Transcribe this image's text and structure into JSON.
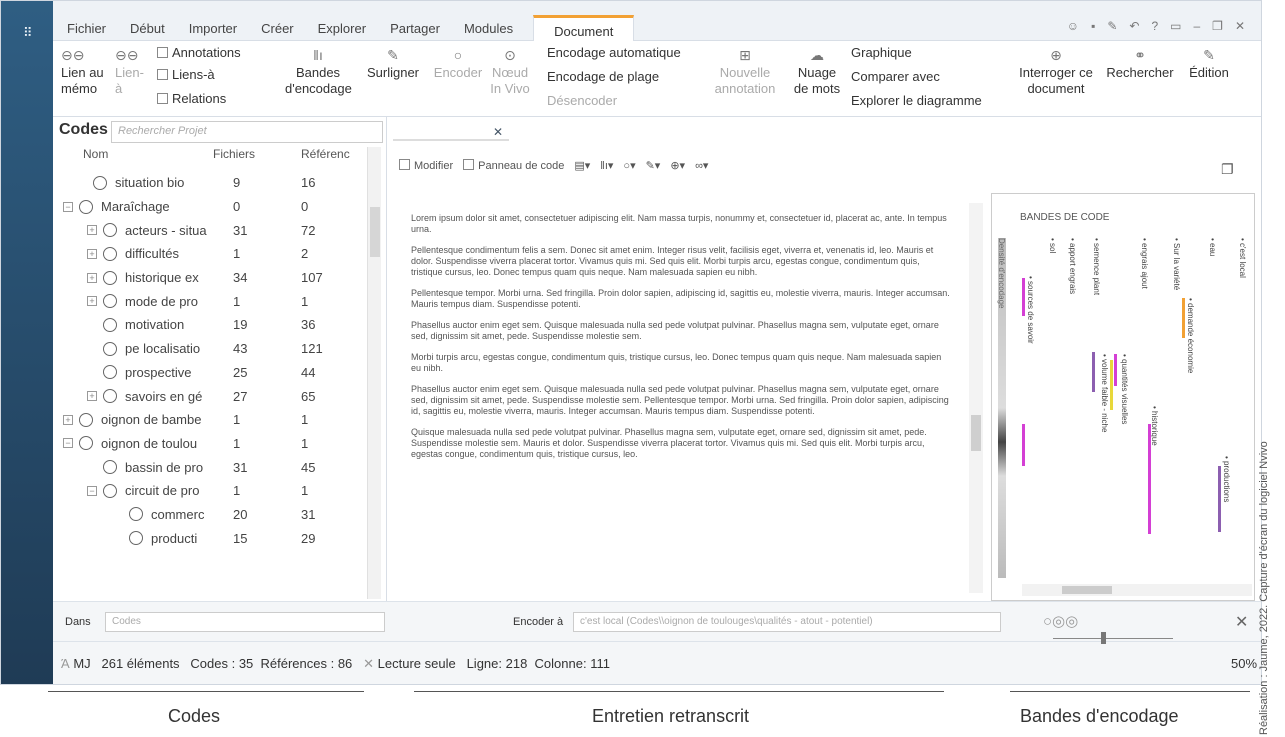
{
  "menu": {
    "tabs": [
      "Fichier",
      "Début",
      "Importer",
      "Créer",
      "Explorer",
      "Partager",
      "Modules",
      "Document"
    ],
    "active": "Document"
  },
  "ribbon": {
    "lien_memo": "Lien au mémo",
    "lien_a": "Lien-à",
    "annotations": "Annotations",
    "liens_a": "Liens-à",
    "relations": "Relations",
    "bandes_codage": "Bandes d'encodage",
    "surligner": "Surligner",
    "encoder": "Encoder",
    "noeud_vivo": "Nœud In Vivo",
    "encodage_auto": "Encodage automatique",
    "encodage_plage": "Encodage de plage",
    "desencoder": "Désencoder",
    "nouvelle_annotation": "Nouvelle annotation",
    "nuage_mots": "Nuage de mots",
    "graphique": "Graphique",
    "comparer": "Comparer avec",
    "explorer_diag": "Explorer le diagramme",
    "interroger": "Interroger ce document",
    "rechercher": "Rechercher",
    "edition": "Édition"
  },
  "codes": {
    "title": "Codes",
    "search_placeholder": "Rechercher Projet",
    "col_nom": "Nom",
    "col_fichiers": "Fichiers",
    "col_ref": "Référenc",
    "rows": [
      {
        "name": "situation bio",
        "f": "9",
        "r": "16",
        "indent": 40,
        "exp": ""
      },
      {
        "name": "Maraîchage",
        "f": "0",
        "r": "0",
        "indent": 10,
        "exp": "−"
      },
      {
        "name": "acteurs - situa",
        "f": "31",
        "r": "72",
        "indent": 34,
        "exp": "+"
      },
      {
        "name": "difficultés",
        "f": "1",
        "r": "2",
        "indent": 34,
        "exp": "+"
      },
      {
        "name": "historique ex",
        "f": "34",
        "r": "107",
        "indent": 34,
        "exp": "+"
      },
      {
        "name": "mode de pro",
        "f": "1",
        "r": "1",
        "indent": 34,
        "exp": "+"
      },
      {
        "name": "motivation",
        "f": "19",
        "r": "36",
        "indent": 50,
        "exp": ""
      },
      {
        "name": "pe localisatio",
        "f": "43",
        "r": "121",
        "indent": 50,
        "exp": ""
      },
      {
        "name": "prospective",
        "f": "25",
        "r": "44",
        "indent": 50,
        "exp": ""
      },
      {
        "name": "savoirs en gé",
        "f": "27",
        "r": "65",
        "indent": 34,
        "exp": "+"
      },
      {
        "name": "oignon de bambe",
        "f": "1",
        "r": "1",
        "indent": 10,
        "exp": "+"
      },
      {
        "name": "oignon de toulou",
        "f": "1",
        "r": "1",
        "indent": 10,
        "exp": "−"
      },
      {
        "name": "bassin de pro",
        "f": "31",
        "r": "45",
        "indent": 50,
        "exp": ""
      },
      {
        "name": "circuit de pro",
        "f": "1",
        "r": "1",
        "indent": 34,
        "exp": "−"
      },
      {
        "name": "commerc",
        "f": "20",
        "r": "31",
        "indent": 76,
        "exp": ""
      },
      {
        "name": "producti",
        "f": "15",
        "r": "29",
        "indent": 76,
        "exp": ""
      }
    ]
  },
  "doc": {
    "modifier": "Modifier",
    "panneau": "Panneau de code",
    "paragraphs": [
      "Lorem ipsum dolor sit amet, consectetuer adipiscing elit. Nam massa turpis, nonummy et, consectetuer id, placerat ac, ante. In tempus urna.",
      "Pellentesque condimentum felis a sem. Donec sit amet enim. Integer risus velit, facilisis eget, viverra et, venenatis id, leo. Mauris et dolor. Suspendisse viverra placerat tortor. Vivamus quis mi. Sed quis elit. Morbi turpis arcu, egestas congue, condimentum quis, tristique cursus, leo. Donec tempus quam quis neque. Nam malesuada sapien eu nibh.",
      "Pellentesque tempor. Morbi urna. Sed fringilla. Proin dolor sapien, adipiscing id, sagittis eu, molestie viverra, mauris. Integer accumsan. Mauris tempus diam. Suspendisse potenti.",
      "Phasellus auctor enim eget sem. Quisque malesuada nulla sed pede volutpat pulvinar. Phasellus magna sem, vulputate eget, ornare sed, dignissim sit amet, pede. Suspendisse molestie sem.",
      "Morbi turpis arcu, egestas congue, condimentum quis, tristique cursus, leo. Donec tempus quam quis neque. Nam malesuada sapien eu nibh.",
      "Phasellus auctor enim eget sem. Quisque malesuada nulla sed pede volutpat pulvinar. Phasellus magna sem, vulputate eget, ornare sed, dignissim sit amet, pede. Suspendisse molestie sem. Pellentesque tempor. Morbi urna. Sed fringilla. Proin dolor sapien, adipiscing id, sagittis eu, molestie viverra, mauris. Integer accumsan. Mauris tempus diam. Suspendisse potenti.",
      "Quisque malesuada nulla sed pede volutpat pulvinar. Phasellus magna sem, vulputate eget, ornare sed, dignissim sit amet, pede. Suspendisse molestie sem. Mauris et dolor. Suspendisse viverra placerat tortor. Vivamus quis mi. Sed quis elit. Morbi turpis arcu, egestas congue, condimentum quis, tristique cursus, leo."
    ]
  },
  "stripes": {
    "title": "BANDES DE CODE",
    "density": "Densité d'encodage",
    "labels": [
      "• sol",
      "• apport engrais",
      "• semence plant",
      "• engrais ajout",
      "• Sur la variété",
      "• eau",
      "• c'est local",
      "• sources de savoir",
      "• demande économie",
      "• quantités visuelles",
      "• volume faible - niche",
      "• historique",
      "• productions"
    ]
  },
  "bottom": {
    "dans": "Dans",
    "dans_placeholder": "Codes",
    "encoder_a": "Encoder à",
    "encoder_path": "c'est local (Codes\\\\oignon de toulouges\\qualités - atout - potentiel)"
  },
  "status": {
    "user": "MJ",
    "elements": "261 éléments",
    "codes": "Codes : 35",
    "refs": "Références : 86",
    "lecture": "Lecture seule",
    "ligne": "Ligne: 218",
    "colonne": "Colonne: 111",
    "zoom": "50%"
  },
  "captions": {
    "codes": "Codes",
    "entretien": "Entretien retranscrit",
    "bandes": "Bandes d'encodage"
  },
  "credit": "Réalisation : Jaume, 2022. Capture d'écran du logiciel Nvivo",
  "colors": {
    "magenta": "#d43fd4",
    "yellow": "#e8d83a",
    "orange": "#f2a134",
    "purple": "#8c5fb0",
    "accent": "#f2a134"
  }
}
